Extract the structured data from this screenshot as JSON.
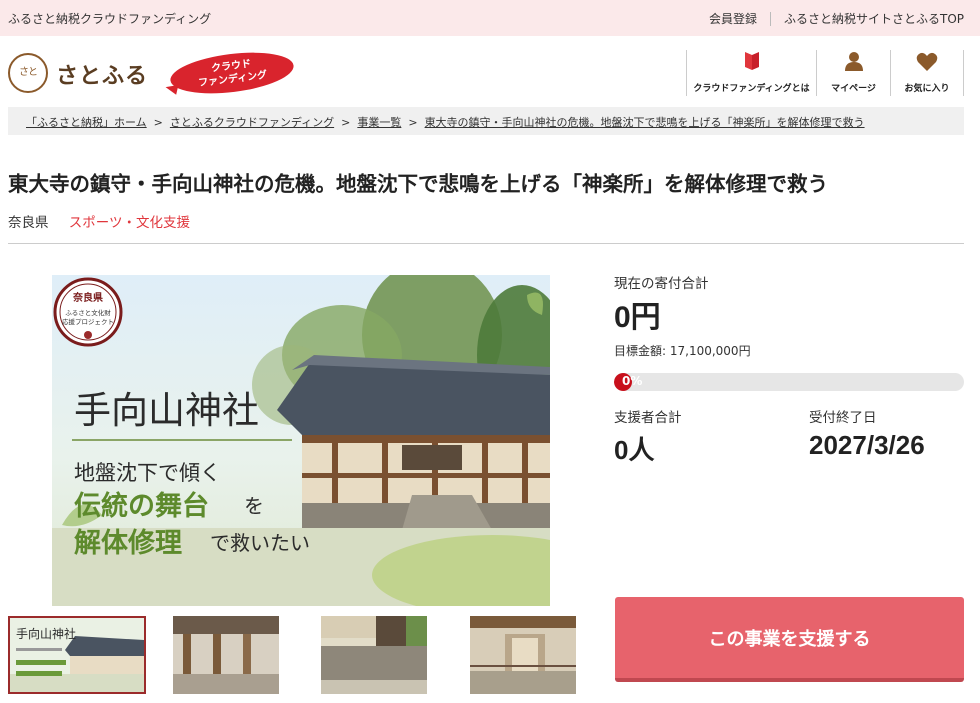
{
  "topbar": {
    "tagline": "ふるさと納税クラウドファンディング",
    "register": "会員登録",
    "top_link": "ふるさと納税サイトさとふるTOP"
  },
  "header": {
    "logo_mark": "さと",
    "logo_text": "さとふる",
    "badge_line1": "クラウド",
    "badge_line2": "ファンディング",
    "nav": [
      {
        "label": "クラウドファンディングとは",
        "icon": "book-icon"
      },
      {
        "label": "マイページ",
        "icon": "user-icon"
      },
      {
        "label": "お気に入り",
        "icon": "heart-icon"
      }
    ]
  },
  "breadcrumb": [
    "「ふるさと納税」ホーム",
    "さとふるクラウドファンディング",
    "事業一覧",
    "東大寺の鎮守・手向山神社の危機。地盤沈下で悲鳴を上げる「神楽所」を解体修理で救う"
  ],
  "project": {
    "title": "東大寺の鎮守・手向山神社の危機。地盤沈下で悲鳴を上げる「神楽所」を解体修理で救う",
    "prefecture": "奈良県",
    "category": "スポーツ・文化支援"
  },
  "image": {
    "seal_top": "奈良県",
    "seal_sub1": "ふるさと文化財",
    "seal_sub2": "応援プロジェクト",
    "heading": "手向山神社",
    "line1": "地盤沈下で傾く",
    "line2a": "伝統の舞台",
    "line2b": "を",
    "line3a": "解体修理",
    "line3b": "で救いたい"
  },
  "stats": {
    "total_label": "現在の寄付合計",
    "total_value": "0円",
    "goal_text": "目標金額: 17,100,000円",
    "progress_text": "0%",
    "progress_fraction": 0,
    "supporters_label": "支援者合計",
    "supporters_value": "0人",
    "deadline_label": "受付終了日",
    "deadline_value": "2027/3/26"
  },
  "cta": {
    "label": "この事業を支援する"
  },
  "colors": {
    "accent": "#d9242d",
    "button": "#e7636c",
    "topbar": "#fbe9ea"
  }
}
